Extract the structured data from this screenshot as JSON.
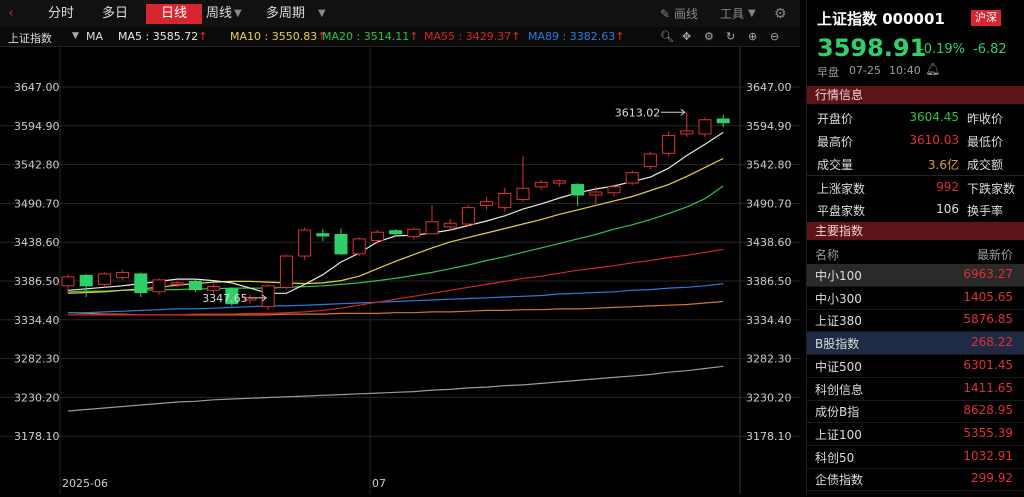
{
  "toolbar": {
    "tabs": [
      "分时",
      "多日",
      "日线",
      "周线",
      "多周期"
    ],
    "draw_label": "画线",
    "tools_label": "工具"
  },
  "indicator_bar": {
    "index_name": "上证指数",
    "ma_label": "MA",
    "ma5": "MA5 : 3585.72",
    "ma10": "MA10 : 3550.83",
    "ma20": "MA20 : 3514.11",
    "ma55": "MA55 : 3429.37",
    "ma89": "MA89 : 3382.63",
    "up_arrow": "↑"
  },
  "chart_data": {
    "type": "candlestick",
    "y_ticks": [
      "3647.00",
      "3594.90",
      "3542.80",
      "3490.70",
      "3438.60",
      "3386.50",
      "3334.40",
      "3282.30",
      "3230.20",
      "3178.10"
    ],
    "x_labels": [
      "2025-06",
      "07"
    ],
    "annotations": {
      "high": "3613.02",
      "low": "3347.65"
    },
    "colors": {
      "up": "#e03030",
      "down": "#2fd06a",
      "ma5": "#e8e8e8",
      "ma10": "#e6d23c",
      "ma20": "#2ec244",
      "ma55": "#d62424",
      "ma89": "#2a7be0",
      "ma_orange": "#d2782a",
      "ma_gray": "#9a9a9a"
    },
    "candles": [
      {
        "o": 3380,
        "c": 3392,
        "h": 3395,
        "l": 3370
      },
      {
        "o": 3394,
        "c": 3380,
        "h": 3396,
        "l": 3365
      },
      {
        "o": 3382,
        "c": 3396,
        "h": 3398,
        "l": 3378
      },
      {
        "o": 3391,
        "c": 3398,
        "h": 3401,
        "l": 3388
      },
      {
        "o": 3396,
        "c": 3371,
        "h": 3398,
        "l": 3365
      },
      {
        "o": 3372,
        "c": 3388,
        "h": 3390,
        "l": 3368
      },
      {
        "o": 3382,
        "c": 3384,
        "h": 3386,
        "l": 3378
      },
      {
        "o": 3386,
        "c": 3375,
        "h": 3388,
        "l": 3372
      },
      {
        "o": 3374,
        "c": 3379,
        "h": 3383,
        "l": 3370
      },
      {
        "o": 3376,
        "c": 3356,
        "h": 3378,
        "l": 3353
      },
      {
        "o": 3361,
        "c": 3364,
        "h": 3368,
        "l": 3356
      },
      {
        "o": 3352,
        "c": 3380,
        "h": 3382,
        "l": 3347.65
      },
      {
        "o": 3378,
        "c": 3420,
        "h": 3422,
        "l": 3375
      },
      {
        "o": 3420,
        "c": 3455,
        "h": 3458,
        "l": 3415
      },
      {
        "o": 3450,
        "c": 3447,
        "h": 3456,
        "l": 3440
      },
      {
        "o": 3449,
        "c": 3423,
        "h": 3457,
        "l": 3421
      },
      {
        "o": 3423,
        "c": 3443,
        "h": 3445,
        "l": 3420
      },
      {
        "o": 3441,
        "c": 3452,
        "h": 3455,
        "l": 3436
      },
      {
        "o": 3454,
        "c": 3450,
        "h": 3456,
        "l": 3446
      },
      {
        "o": 3446,
        "c": 3456,
        "h": 3458,
        "l": 3442
      },
      {
        "o": 3450,
        "c": 3466,
        "h": 3488,
        "l": 3449
      },
      {
        "o": 3459,
        "c": 3464,
        "h": 3470,
        "l": 3454
      },
      {
        "o": 3463,
        "c": 3485,
        "h": 3488,
        "l": 3460
      },
      {
        "o": 3488,
        "c": 3493,
        "h": 3500,
        "l": 3482
      },
      {
        "o": 3485,
        "c": 3504,
        "h": 3512,
        "l": 3480
      },
      {
        "o": 3496,
        "c": 3511,
        "h": 3554,
        "l": 3493
      },
      {
        "o": 3513,
        "c": 3519,
        "h": 3522,
        "l": 3509
      },
      {
        "o": 3518,
        "c": 3521,
        "h": 3523,
        "l": 3513
      },
      {
        "o": 3516,
        "c": 3502,
        "h": 3518,
        "l": 3487
      },
      {
        "o": 3502,
        "c": 3506,
        "h": 3513,
        "l": 3490
      },
      {
        "o": 3505,
        "c": 3513,
        "h": 3516,
        "l": 3500
      },
      {
        "o": 3518,
        "c": 3532,
        "h": 3535,
        "l": 3515
      },
      {
        "o": 3540,
        "c": 3557,
        "h": 3560,
        "l": 3537
      },
      {
        "o": 3558,
        "c": 3582,
        "h": 3587,
        "l": 3554
      },
      {
        "o": 3584,
        "c": 3588,
        "h": 3613.02,
        "l": 3580
      },
      {
        "o": 3584,
        "c": 3603,
        "h": 3606,
        "l": 3580
      },
      {
        "o": 3604,
        "c": 3599,
        "h": 3610,
        "l": 3593
      }
    ],
    "ma5_values": [
      3374,
      3376,
      3378,
      3380,
      3383,
      3386,
      3389,
      3389,
      3387,
      3384,
      3377,
      3370,
      3370,
      3382,
      3395,
      3412,
      3424,
      3439,
      3447,
      3448,
      3451,
      3455,
      3461,
      3467,
      3474,
      3483,
      3490,
      3498,
      3505,
      3510,
      3514,
      3520,
      3526,
      3538,
      3555,
      3570,
      3586
    ],
    "ma10_values": [
      3370,
      3371,
      3372,
      3374,
      3376,
      3378,
      3381,
      3383,
      3385,
      3386,
      3386,
      3385,
      3384,
      3383,
      3384,
      3387,
      3393,
      3403,
      3413,
      3422,
      3431,
      3439,
      3445,
      3451,
      3457,
      3463,
      3469,
      3476,
      3482,
      3488,
      3494,
      3500,
      3508,
      3516,
      3527,
      3539,
      3551
    ],
    "ma20_values": [
      3372,
      3373,
      3373,
      3374,
      3374,
      3375,
      3375,
      3376,
      3376,
      3377,
      3377,
      3377,
      3378,
      3379,
      3380,
      3382,
      3384,
      3387,
      3390,
      3394,
      3398,
      3403,
      3408,
      3414,
      3419,
      3425,
      3431,
      3437,
      3443,
      3449,
      3456,
      3462,
      3469,
      3477,
      3486,
      3497,
      3514
    ],
    "ma55_values": [
      3341,
      3341,
      3341,
      3341,
      3341,
      3341,
      3341,
      3342,
      3342,
      3342,
      3343,
      3343,
      3344,
      3345,
      3347,
      3350,
      3354,
      3358,
      3362,
      3366,
      3370,
      3374,
      3378,
      3382,
      3386,
      3390,
      3393,
      3397,
      3401,
      3404,
      3407,
      3411,
      3414,
      3418,
      3421,
      3425,
      3429
    ],
    "ma89_values": [
      3344,
      3344,
      3345,
      3346,
      3347,
      3348,
      3349,
      3349,
      3350,
      3351,
      3352,
      3353,
      3353,
      3354,
      3355,
      3356,
      3357,
      3358,
      3359,
      3360,
      3361,
      3362,
      3363,
      3364,
      3365,
      3366,
      3367,
      3369,
      3370,
      3371,
      3372,
      3374,
      3375,
      3377,
      3378,
      3380,
      3383
    ],
    "orange_values": [
      3344,
      3343,
      3342,
      3342,
      3341,
      3341,
      3341,
      3341,
      3341,
      3341,
      3341,
      3341,
      3342,
      3342,
      3342,
      3343,
      3343,
      3343,
      3344,
      3344,
      3345,
      3345,
      3346,
      3347,
      3347,
      3348,
      3348,
      3349,
      3349,
      3350,
      3351,
      3352,
      3353,
      3354,
      3355,
      3357,
      3359
    ],
    "gray_values": [
      3212,
      3214,
      3216,
      3218,
      3220,
      3222,
      3224,
      3225,
      3227,
      3228,
      3229,
      3230,
      3231,
      3232,
      3233,
      3234,
      3235,
      3236,
      3237,
      3238,
      3240,
      3241,
      3243,
      3244,
      3246,
      3247,
      3249,
      3251,
      3253,
      3255,
      3257,
      3259,
      3261,
      3264,
      3266,
      3269,
      3272
    ]
  },
  "quote": {
    "name": "上证指数 000001",
    "badge": "沪深",
    "price": "3598.91",
    "change_pct": "-0.19%",
    "change": "-6.82",
    "session": "早盘",
    "date": "07-25",
    "time": "10:40"
  },
  "market_info": {
    "title": "行情信息",
    "rows": [
      {
        "label": "开盘价",
        "value": "3604.45",
        "label2": "昨收价"
      },
      {
        "label": "最高价",
        "value": "3610.03",
        "label2": "最低价"
      },
      {
        "label": "成交量",
        "value": "3.6亿",
        "label2": "成交额"
      },
      {
        "label": "上涨家数",
        "value": "992",
        "label2": "下跌家数"
      },
      {
        "label": "平盘家数",
        "value": "106",
        "label2": "换手率"
      }
    ]
  },
  "main_indices": {
    "title": "主要指数",
    "col_name": "名称",
    "col_price": "最新价",
    "items": [
      {
        "name": "中小100",
        "price": "6963.27",
        "selected": true
      },
      {
        "name": "中小300",
        "price": "1405.65"
      },
      {
        "name": "上证380",
        "price": "5876.85"
      },
      {
        "name": "B股指数",
        "price": "268.22",
        "highlight": true
      },
      {
        "name": "中证500",
        "price": "6301.45"
      },
      {
        "name": "科创信息",
        "price": "1411.65"
      },
      {
        "name": "成份B指",
        "price": "8628.95"
      },
      {
        "name": "上证100",
        "price": "5355.39"
      },
      {
        "name": "科创50",
        "price": "1032.91"
      },
      {
        "name": "企债指数",
        "price": "299.92"
      }
    ]
  }
}
